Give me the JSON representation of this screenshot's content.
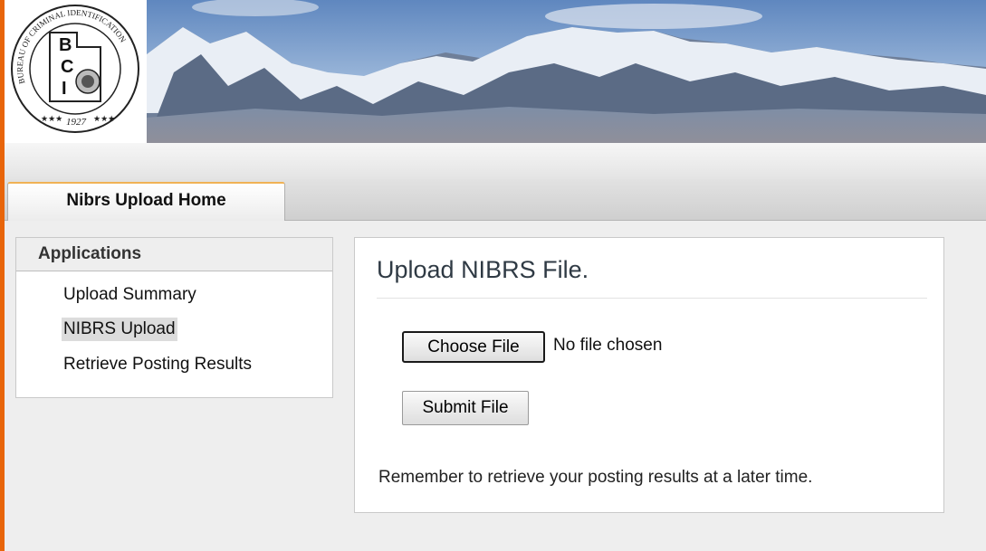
{
  "logo": {
    "ring_text_left": "BUREAU OF CRIMINAL IDENTIFICATION",
    "letters": [
      "B",
      "C",
      "I"
    ],
    "year": "1927",
    "stars": "★★★"
  },
  "tabs": [
    {
      "label": "Nibrs Upload Home",
      "active": true
    }
  ],
  "sidebar": {
    "heading": "Applications",
    "items": [
      {
        "label": "Upload Summary",
        "active": false
      },
      {
        "label": "NIBRS Upload",
        "active": true
      },
      {
        "label": "Retrieve Posting Results",
        "active": false
      }
    ]
  },
  "main": {
    "title": "Upload NIBRS File.",
    "file_button": "Choose File",
    "file_status": "No file chosen",
    "submit_label": "Submit File",
    "note": "Remember to retrieve your posting results at a later time."
  },
  "colors": {
    "accent": "#e8650a",
    "tab_highlight": "#f0b255",
    "title_text": "#2f3a44"
  }
}
